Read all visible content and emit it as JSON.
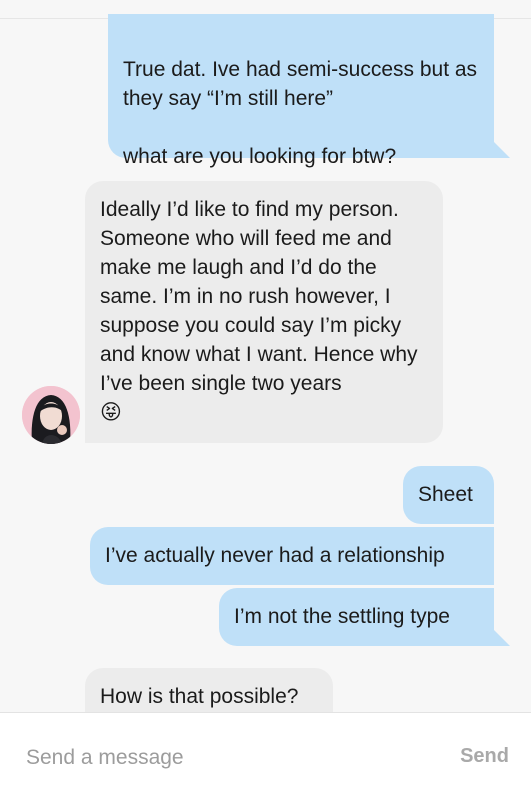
{
  "conversation": {
    "messages": [
      {
        "direction": "outgoing",
        "text": "True dat. Ive had semi-success but as they say “I’m still here”\n\nwhat are you looking for btw?"
      },
      {
        "direction": "incoming",
        "text": "Ideally I’d like to find my person. Someone who will feed me and make me laugh and I’d do the same. I’m in no rush however, I suppose you could say I’m picky and know what I want. Hence why I’ve been single two years",
        "emoji": "😝"
      },
      {
        "direction": "outgoing",
        "text": "Sheet"
      },
      {
        "direction": "outgoing",
        "text": "I’ve actually never had a relationship"
      },
      {
        "direction": "outgoing",
        "text": "I’m not the settling type"
      },
      {
        "direction": "incoming",
        "text": "How is that possible?"
      }
    ]
  },
  "composer": {
    "placeholder": "Send a message",
    "send_label": "Send"
  },
  "colors": {
    "outgoing_bubble": "#bfe0f8",
    "incoming_bubble": "#ececec",
    "background": "#f7f7f7"
  }
}
